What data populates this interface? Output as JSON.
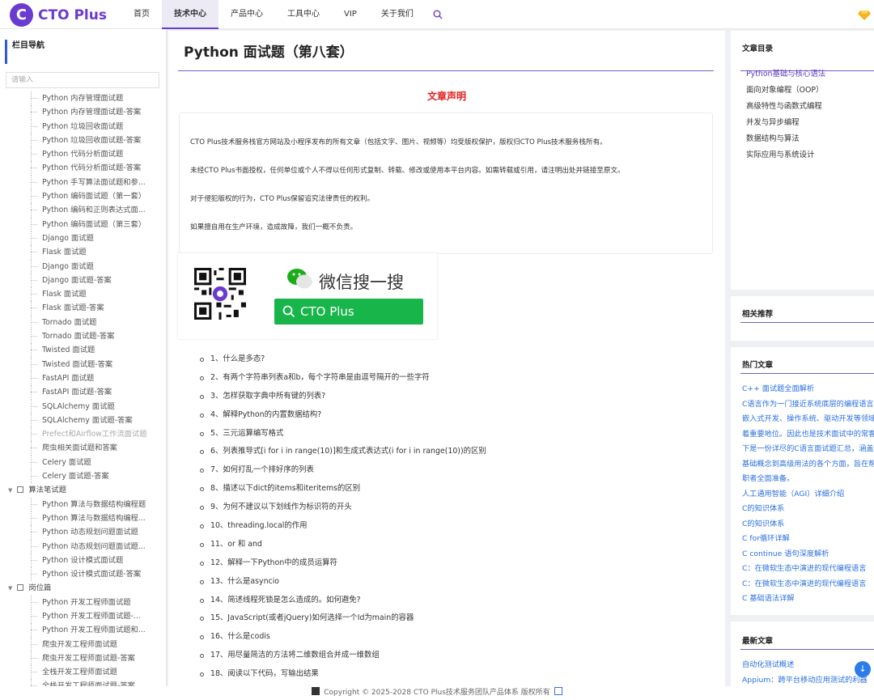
{
  "brand": {
    "logo_letter": "C",
    "name": "CTO Plus",
    "accent": "#6a3bd0"
  },
  "nav": [
    {
      "label": "首页",
      "active": false
    },
    {
      "label": "技术中心",
      "active": true
    },
    {
      "label": "产品中心",
      "active": false
    },
    {
      "label": "工具中心",
      "active": false
    },
    {
      "label": "VIP",
      "active": false
    },
    {
      "label": "关于我们",
      "active": false
    }
  ],
  "sidebar": {
    "heading": "栏目导航",
    "search_placeholder": "请输入",
    "items": [
      {
        "label": "Python 内存管理面试题",
        "kind": "item"
      },
      {
        "label": "Python 内存管理面试题-答案",
        "kind": "item"
      },
      {
        "label": "Python 垃圾回收面试题",
        "kind": "item"
      },
      {
        "label": "Python 垃圾回收面试题-答案",
        "kind": "item"
      },
      {
        "label": "Python 代码分析面试题",
        "kind": "item"
      },
      {
        "label": "Python 代码分析面试题-答案",
        "kind": "item"
      },
      {
        "label": "Python 手写算法面试题和参...",
        "kind": "item"
      },
      {
        "label": "Python 编码面试题（第一套）",
        "kind": "item"
      },
      {
        "label": "Python 编码和正则表达式面...",
        "kind": "item"
      },
      {
        "label": "Python 编码面试题（第三套）",
        "kind": "item"
      },
      {
        "label": "Django 面试题",
        "kind": "item"
      },
      {
        "label": "Flask 面试题",
        "kind": "item"
      },
      {
        "label": "Django 面试题",
        "kind": "item"
      },
      {
        "label": "Django 面试题-答案",
        "kind": "item"
      },
      {
        "label": "Flask 面试题",
        "kind": "item"
      },
      {
        "label": "Flask 面试题-答案",
        "kind": "item"
      },
      {
        "label": "Tornado 面试题",
        "kind": "item"
      },
      {
        "label": "Tornado 面试题-答案",
        "kind": "item"
      },
      {
        "label": "Twisted 面试题",
        "kind": "item"
      },
      {
        "label": "Twisted 面试题-答案",
        "kind": "item"
      },
      {
        "label": "FastAPI 面试题",
        "kind": "item"
      },
      {
        "label": "FastAPI 面试题-答案",
        "kind": "item"
      },
      {
        "label": "SQLAlchemy 面试题",
        "kind": "item"
      },
      {
        "label": "SQLAlchemy 面试题-答案",
        "kind": "item"
      },
      {
        "label": "Prefect和Airflow工作流面试题",
        "kind": "dim"
      },
      {
        "label": "爬虫相关面试题和答案",
        "kind": "item"
      },
      {
        "label": "Celery 面试题",
        "kind": "item"
      },
      {
        "label": "Celery 面试题-答案",
        "kind": "item"
      },
      {
        "label": "算法笔试题",
        "kind": "cat"
      },
      {
        "label": "Python 算法与数据结构编程题",
        "kind": "item"
      },
      {
        "label": "Python 算法与数据结构编程...",
        "kind": "item"
      },
      {
        "label": "Python 动态规划问题面试题",
        "kind": "item"
      },
      {
        "label": "Python 动态规划问题面试题...",
        "kind": "item"
      },
      {
        "label": "Python 设计模式面试题",
        "kind": "item"
      },
      {
        "label": "Python 设计模式面试题-答案",
        "kind": "item"
      },
      {
        "label": "岗位篇",
        "kind": "cat"
      },
      {
        "label": "Python 开发工程师面试题",
        "kind": "item"
      },
      {
        "label": "Python 开发工程师面试题-...",
        "kind": "item"
      },
      {
        "label": "Python 开发工程师面试题和...",
        "kind": "item"
      },
      {
        "label": "爬虫开发工程师面试题",
        "kind": "item"
      },
      {
        "label": "爬虫开发工程师面试题-答案",
        "kind": "item"
      },
      {
        "label": "全栈开发工程师面试题",
        "kind": "item"
      },
      {
        "label": "全栈开发工程师面试题-答案",
        "kind": "item"
      }
    ]
  },
  "article": {
    "title": "Python 面试题（第八套）",
    "declaration_title": "文章声明",
    "declaration": [
      "CTO Plus技术服务栈官方网站及小程序发布的所有文章（包括文字、图片、视频等）均受版权保护，版权归CTO Plus技术服务栈所有。",
      "未经CTO Plus书面授权，任何单位或个人不得以任何形式复制、转载、修改或使用本平台内容。如需转载或引用，请注明出处并链接至原文。",
      "对于侵犯版权的行为，CTO Plus保留追究法律责任的权利。",
      "如果擅自用在生产环境，造成故障，我们一概不负责。"
    ],
    "promo": {
      "wechat_text": "微信搜一搜",
      "button_label": "CTO Plus"
    },
    "questions": [
      "1、什么是多态?",
      "2、有两个字符串列表a和b，每个字符串是由逗号隔开的一些字符",
      "3、怎样获取字典中所有键的列表?",
      "4、解释Python的内置数据结构?",
      "5、三元运算编写格式",
      "6、列表推导式[i for i in range(10)]和生成式表达式(i for i in range(10))的区别",
      "7、如何打乱一个排好序的列表",
      "8、描述以下dict的items和iteritems的区别",
      "9、为何不建议以下划线作为标识符的开头",
      "10、threading.local的作用",
      "11、or 和 and",
      "12、解释一下Python中的成员运算符",
      "13、什么是asyncio",
      "14、简述线程死锁是怎么造成的。如何避免?",
      "15、JavaScript(或者jQuery)如何选择一个Id为main的容器",
      "16、什么是codis",
      "17、用尽量简洁的方法将二维数组合并成一维数组",
      "18、阅读以下代码，写输出结果"
    ]
  },
  "right": {
    "toc_title": "文章目录",
    "toc": [
      "Python基础与核心语法",
      "面向对象编程（OOP）",
      "高级特性与函数式编程",
      "并发与异步编程",
      "数据结构与算法",
      "实际应用与系统设计"
    ],
    "related_title": "相关推荐",
    "hot_title": "热门文章",
    "hot": [
      "C++ 面试题全面解析",
      "C语言作为一门接近系统底层的编程语言",
      "嵌入式开发、操作系统、驱动开发等领域",
      "着重要地位。因此也是技术面试中的常客",
      "下是一份详尽的C语言面试题汇总，涵盖",
      "基础概念到高级用法的各个方面，旨在帮",
      "职者全面准备。",
      "人工通用智能（AGI）详细介绍",
      "C的知识体系",
      "C的知识体系",
      "C for循环详解",
      "C continue 语句深度解析",
      "C：在微软生态中演进的现代编程语言",
      "C：在微软生态中演进的现代编程语言",
      "C 基础语法详解"
    ],
    "latest_title": "最新文章",
    "latest": [
      "自动化测试概述",
      "Appium：跨平台移动应用测试的利器"
    ]
  },
  "footer": {
    "text": "Copyright © 2025-2028 CTO Plus技术服务团队产品体系 版权所有"
  },
  "icons": {
    "search": "search-icon",
    "diamond": "diamond-icon",
    "back_to_top": "arrow-down-icon"
  }
}
